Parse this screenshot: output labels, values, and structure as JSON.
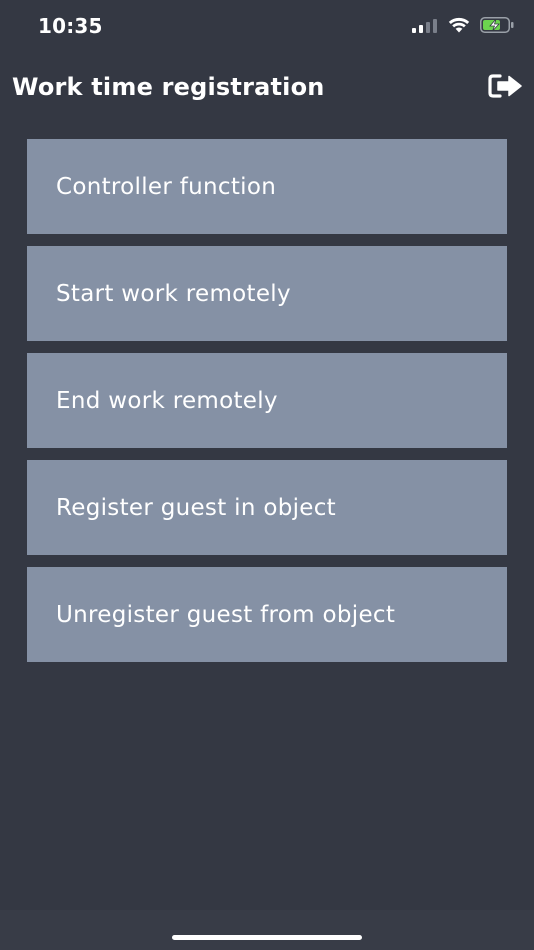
{
  "status_bar": {
    "time": "10:35",
    "icons": [
      "signal-icon",
      "wifi-icon",
      "battery-charging-icon"
    ]
  },
  "header": {
    "title": "Work time registration",
    "logout_icon": "logout-icon"
  },
  "menu": {
    "items": [
      {
        "label": "Controller function"
      },
      {
        "label": "Start work remotely"
      },
      {
        "label": "End work remotely"
      },
      {
        "label": "Register guest in object"
      },
      {
        "label": "Unregister guest from object"
      }
    ]
  },
  "colors": {
    "background": "#343843",
    "menu_item": "#8591a5",
    "text": "#ffffff",
    "battery_accent": "#6cd34f"
  }
}
